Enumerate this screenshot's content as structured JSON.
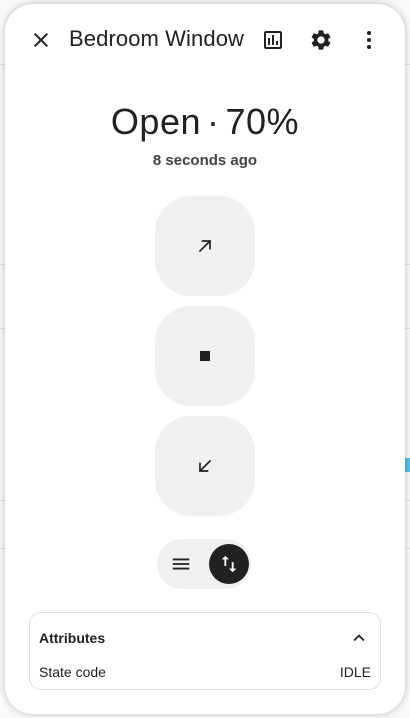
{
  "dialog": {
    "title": "Bedroom Window",
    "icons": {
      "close": "close-icon",
      "history": "chart-box-icon",
      "settings": "gear-icon",
      "more": "dots-vertical-icon"
    }
  },
  "state": {
    "label": "Open",
    "separator": "·",
    "position": "70%",
    "last_changed": "8 seconds ago"
  },
  "controls": {
    "open": "arrow-top-right-icon",
    "stop": "stop-icon",
    "close": "arrow-bottom-left-icon"
  },
  "mode_toggle": {
    "buttons": [
      "menu-icon",
      "swap-vertical-icon"
    ],
    "active": "swap-vertical-icon"
  },
  "attributes": {
    "title": "Attributes",
    "rows": [
      {
        "key": "State code",
        "value": "IDLE"
      }
    ]
  },
  "colors": {
    "control_bg": "#f0f0f0",
    "active_toggle": "#212121",
    "text": "#212121",
    "border": "#e0e0e0"
  }
}
